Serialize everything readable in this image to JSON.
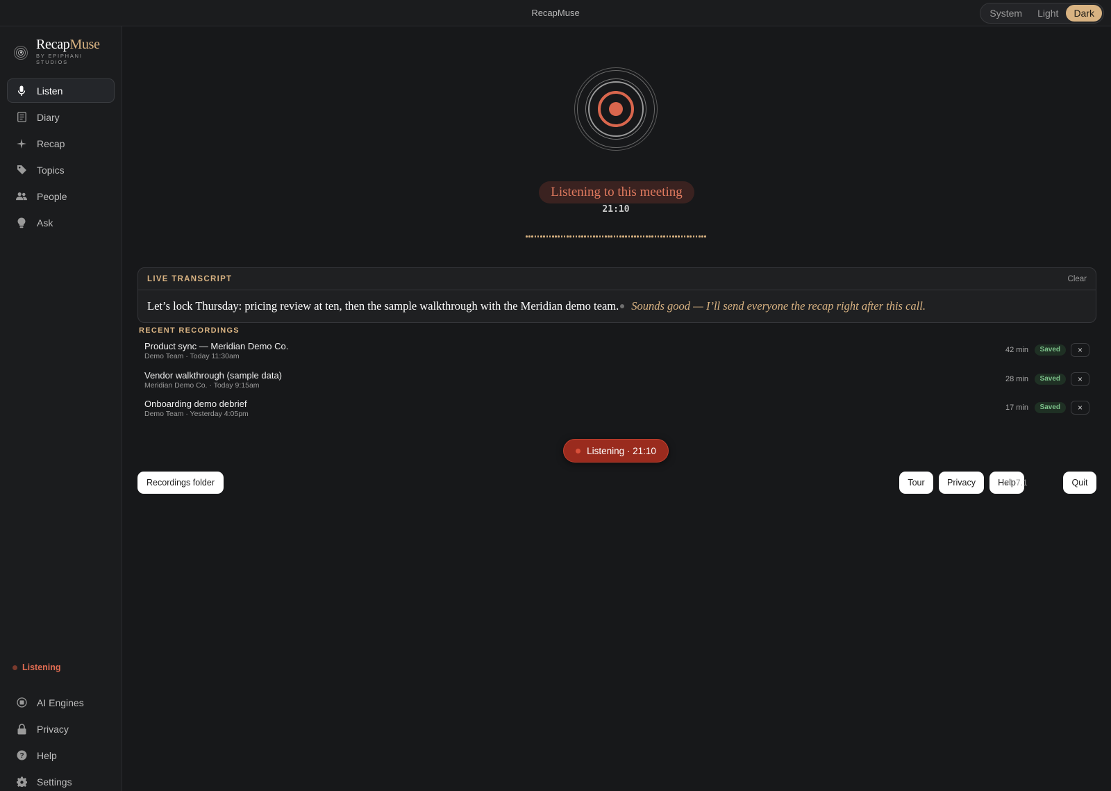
{
  "titlebar": {
    "title": "RecapMuse",
    "theme_options": [
      "System",
      "Light",
      "Dark"
    ],
    "theme_selected": "Dark"
  },
  "brand": {
    "name_part1": "Recap",
    "name_part2": "Muse",
    "subtitle": "BY EPIPHANI STUDIOS"
  },
  "nav": {
    "items": [
      {
        "label": "Listen",
        "icon": "microphone-icon",
        "active": true
      },
      {
        "label": "Diary",
        "icon": "notebook-icon"
      },
      {
        "label": "Recap",
        "icon": "sparkle-icon"
      },
      {
        "label": "Topics",
        "icon": "tag-icon"
      },
      {
        "label": "People",
        "icon": "people-icon"
      },
      {
        "label": "Ask",
        "icon": "lightbulb-icon"
      }
    ],
    "status_label": "Listening",
    "bottom_items": [
      {
        "label": "AI Engines",
        "icon": "chip-icon"
      },
      {
        "label": "Privacy",
        "icon": "lock-icon"
      },
      {
        "label": "Help",
        "icon": "help-icon"
      },
      {
        "label": "Settings",
        "icon": "gear-icon"
      }
    ]
  },
  "listen": {
    "status_label": "Listening to this meeting",
    "timer": "21:10"
  },
  "transcript": {
    "title": "LIVE TRANSCRIPT",
    "clear_label": "Clear",
    "final_text": "Let’s lock Thursday: pricing review at ten, then the sample walkthrough with the Meridian demo team.",
    "partial_text": "Sounds good — I’ll send everyone the recap right after this call."
  },
  "recent": {
    "title": "RECENT RECORDINGS",
    "items": [
      {
        "title": "Product sync — Meridian Demo Co.",
        "meta": "Demo Team · Today 11:30am",
        "duration": "42 min",
        "status": "Saved"
      },
      {
        "title": "Vendor walkthrough (sample data)",
        "meta": "Meridian Demo Co. · Today 9:15am",
        "duration": "28 min",
        "status": "Saved"
      },
      {
        "title": "Onboarding demo debrief",
        "meta": "Demo Team · Yesterday 4:05pm",
        "duration": "17 min",
        "status": "Saved"
      }
    ],
    "delete_label": "×"
  },
  "listening_button": {
    "label": "Listening · 21:10"
  },
  "footer": {
    "recordings_folder": "Recordings folder",
    "tour": "Tour",
    "privacy": "Privacy",
    "help": "Help",
    "version": "v1.7.1",
    "quit": "Quit"
  },
  "colors": {
    "accent": "#d9b382",
    "recording": "#e07a5f",
    "background": "#17181a",
    "saved": "#7cc18a"
  }
}
